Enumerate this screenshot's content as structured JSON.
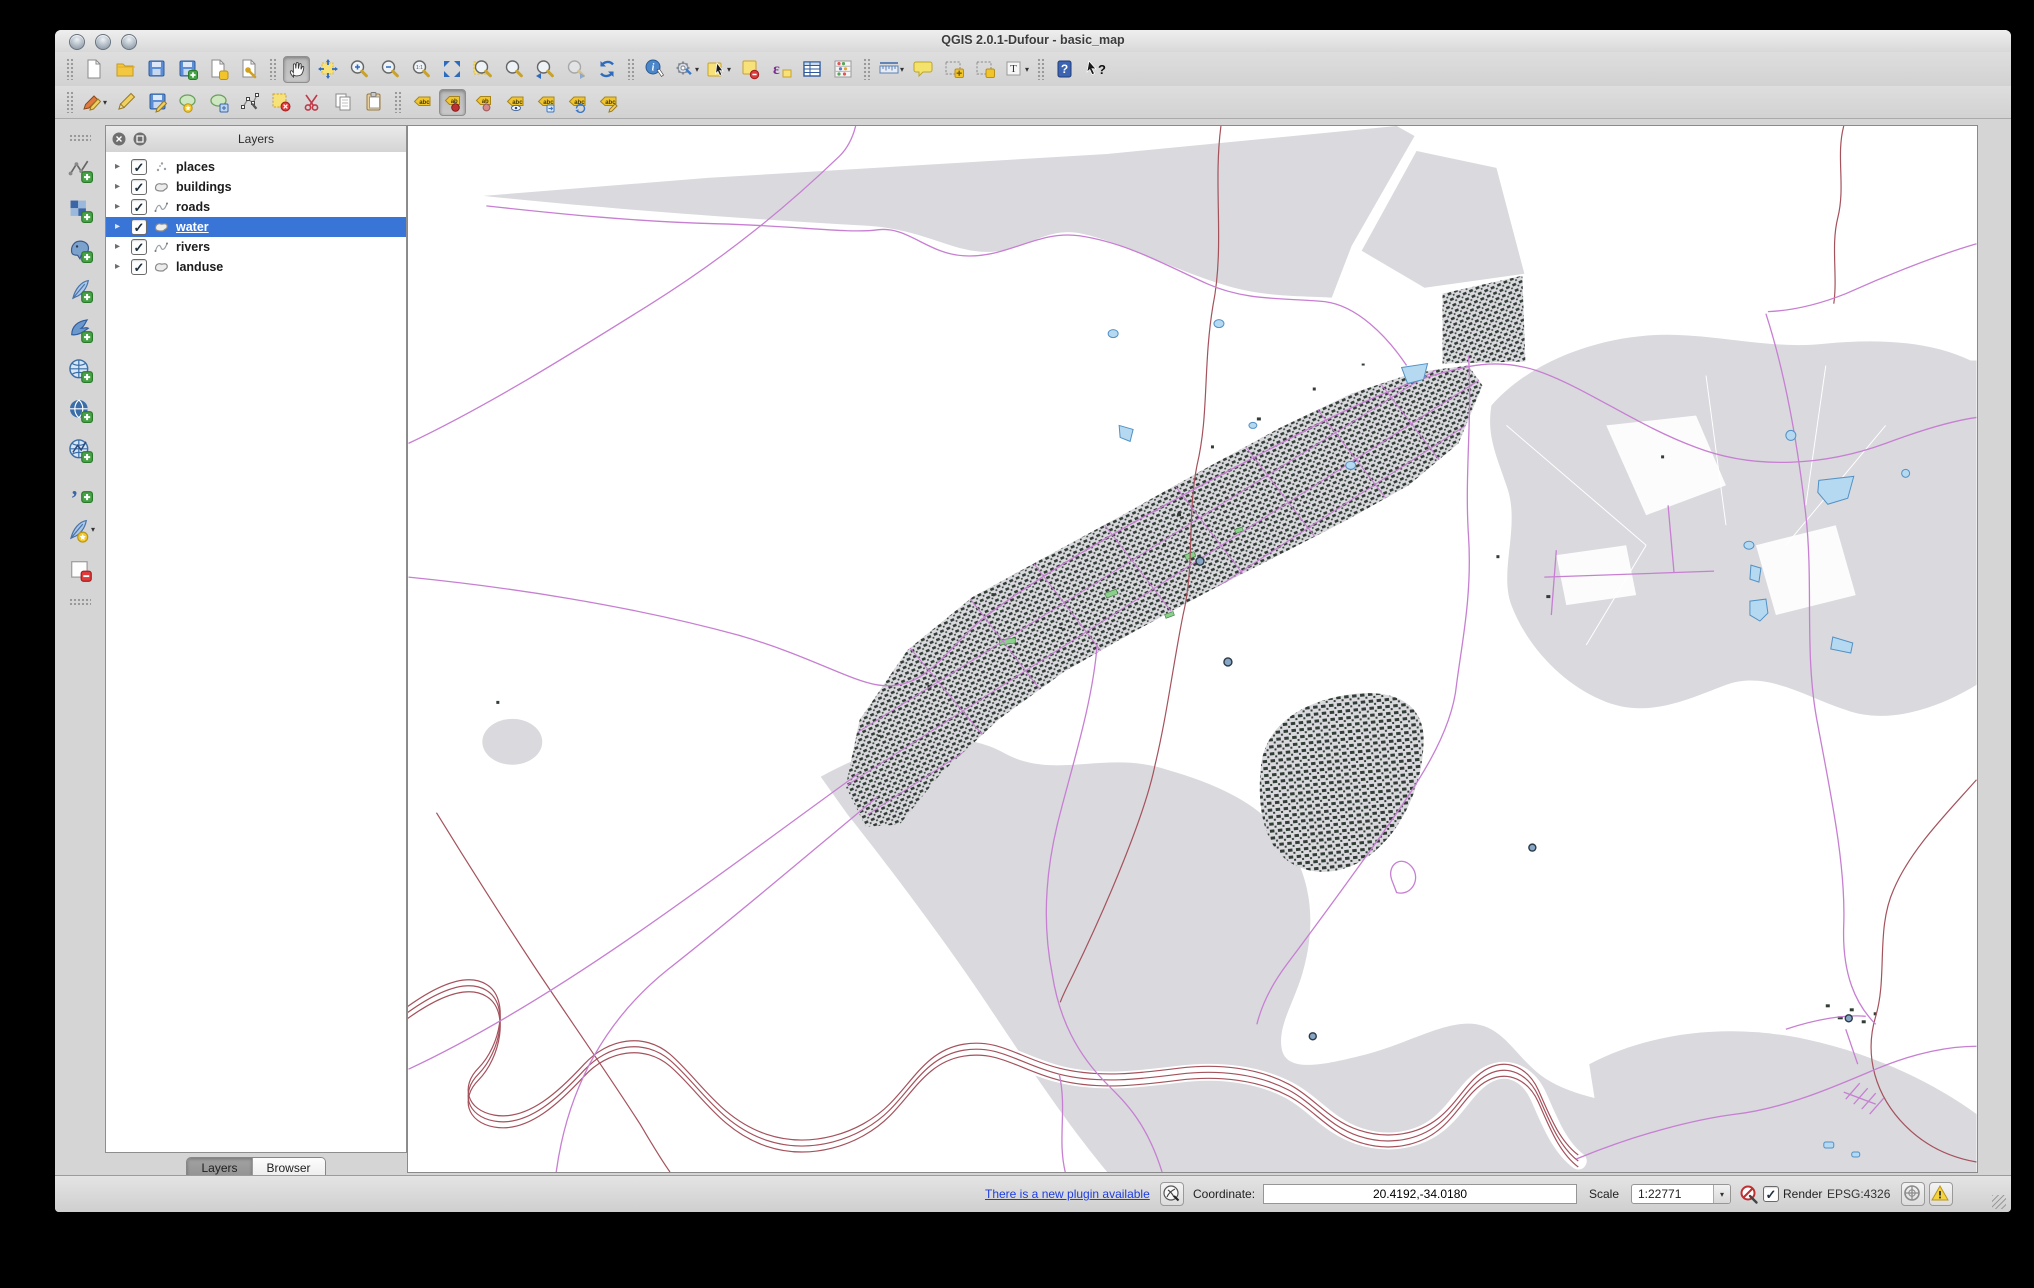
{
  "window": {
    "title": "QGIS 2.0.1-Dufour - basic_map"
  },
  "titlebar": {
    "buttons": [
      "close",
      "minimize",
      "zoom"
    ]
  },
  "toolbars": {
    "main": [
      {
        "sep": true
      },
      {
        "name": "new-project",
        "icon": "page"
      },
      {
        "name": "open-project",
        "icon": "folder"
      },
      {
        "name": "save-project",
        "icon": "floppy"
      },
      {
        "name": "save-project-as",
        "icon": "floppy-plus"
      },
      {
        "name": "new-print-composer",
        "icon": "page-plus"
      },
      {
        "name": "composer-manager",
        "icon": "page-wrench"
      },
      {
        "sep": true
      },
      {
        "name": "pan-map",
        "icon": "hand",
        "active": true
      },
      {
        "name": "pan-to-selection",
        "icon": "pan-selection"
      },
      {
        "name": "zoom-in",
        "icon": "zoom-in"
      },
      {
        "name": "zoom-out",
        "icon": "zoom-out"
      },
      {
        "name": "zoom-actual-size",
        "icon": "zoom-actual"
      },
      {
        "name": "zoom-full-extent",
        "icon": "zoom-full"
      },
      {
        "name": "zoom-to-selection",
        "icon": "zoom-selection"
      },
      {
        "name": "zoom-to-layer",
        "icon": "zoom-layer"
      },
      {
        "name": "zoom-last",
        "icon": "zoom-last"
      },
      {
        "name": "zoom-next",
        "icon": "zoom-next",
        "disabled": true
      },
      {
        "name": "refresh-map",
        "icon": "refresh"
      },
      {
        "sep": true
      },
      {
        "name": "identify-features",
        "icon": "identify"
      },
      {
        "name": "run-feature-action",
        "icon": "feature-action",
        "dropdown": true
      },
      {
        "name": "select-features",
        "icon": "select-rectangle",
        "dropdown": true
      },
      {
        "name": "deselect-features",
        "icon": "deselect"
      },
      {
        "name": "select-by-expression",
        "icon": "select-expression"
      },
      {
        "name": "open-attribute-table",
        "icon": "attribute-table"
      },
      {
        "name": "field-calculator",
        "icon": "field-calculator"
      },
      {
        "sep": true
      },
      {
        "name": "measure-line",
        "icon": "measure",
        "dropdown": true
      },
      {
        "name": "map-tips",
        "icon": "map-tips"
      },
      {
        "name": "new-bookmark",
        "icon": "bookmark-new"
      },
      {
        "name": "show-bookmarks",
        "icon": "bookmark-show"
      },
      {
        "name": "text-annotation",
        "icon": "text-annotation",
        "dropdown": true
      },
      {
        "sep": true
      },
      {
        "name": "help-contents",
        "icon": "help"
      },
      {
        "name": "whats-this",
        "icon": "whats-this"
      }
    ],
    "digitizing": [
      {
        "sep": true
      },
      {
        "name": "current-edits",
        "icon": "current-edits",
        "dropdown": true
      },
      {
        "name": "toggle-editing",
        "icon": "toggle-editing"
      },
      {
        "name": "save-layer-edits",
        "icon": "save-edits"
      },
      {
        "name": "add-feature",
        "icon": "add-feature"
      },
      {
        "name": "move-feature",
        "icon": "move-feature"
      },
      {
        "name": "node-tool",
        "icon": "node-tool"
      },
      {
        "name": "delete-selected",
        "icon": "delete-selected"
      },
      {
        "name": "cut-features",
        "icon": "cut-features"
      },
      {
        "name": "copy-features",
        "icon": "copy-features"
      },
      {
        "name": "paste-features",
        "icon": "paste-features"
      },
      {
        "sep": true
      },
      {
        "name": "layer-labeling-options",
        "icon": "label-options"
      },
      {
        "name": "pin-labels",
        "icon": "label-pin",
        "active": true
      },
      {
        "name": "highlight-pinned-labels",
        "icon": "label-pin-toggle"
      },
      {
        "name": "show-hide-labels",
        "icon": "label-visibility"
      },
      {
        "name": "move-label",
        "icon": "label-move"
      },
      {
        "name": "rotate-label",
        "icon": "label-rotate"
      },
      {
        "name": "change-label",
        "icon": "label-properties"
      }
    ],
    "layer_tools": [
      {
        "sep": true
      },
      {
        "name": "add-vector-layer",
        "icon": "add-vector"
      },
      {
        "name": "add-raster-layer",
        "icon": "add-raster"
      },
      {
        "name": "add-postgis-layer",
        "icon": "add-postgis"
      },
      {
        "name": "add-spatialite-layer",
        "icon": "add-spatialite"
      },
      {
        "name": "add-mssql-layer",
        "icon": "add-mssql"
      },
      {
        "name": "add-wms-layer",
        "icon": "add-wms"
      },
      {
        "name": "add-wcs-layer",
        "icon": "add-wcs"
      },
      {
        "name": "add-wfs-layer",
        "icon": "add-wfs"
      },
      {
        "name": "add-delimited-text-layer",
        "icon": "add-delimited-text"
      },
      {
        "name": "new-shapefile-layer",
        "icon": "new-shapefile",
        "dropdown": true
      },
      {
        "name": "remove-layer",
        "icon": "remove-layer"
      },
      {
        "sep": true
      }
    ]
  },
  "layers_panel": {
    "title": "Layers",
    "selection_color": "#3875d7",
    "layers": [
      {
        "label": "places",
        "geometry": "point",
        "checked": true,
        "selected": false
      },
      {
        "label": "buildings",
        "geometry": "polygon",
        "checked": true,
        "selected": false
      },
      {
        "label": "roads",
        "geometry": "line",
        "checked": true,
        "selected": false
      },
      {
        "label": "water",
        "geometry": "polygon",
        "checked": true,
        "selected": true
      },
      {
        "label": "rivers",
        "geometry": "line",
        "checked": true,
        "selected": false
      },
      {
        "label": "landuse",
        "geometry": "polygon",
        "checked": true,
        "selected": false
      }
    ],
    "tabs": [
      {
        "label": "Layers",
        "active": true
      },
      {
        "label": "Browser",
        "active": false
      }
    ]
  },
  "status_bar": {
    "plugin_link": "There is a new plugin available",
    "coordinate_label": "Coordinate:",
    "coordinate_value": "20.4192,-34.0180",
    "scale_label": "Scale",
    "scale_value": "1:22771",
    "render_label": "Render",
    "render_checked": true,
    "crs": "EPSG:4326"
  },
  "map": {
    "colors": {
      "landuse": "#d9d9de",
      "roads": "#c77fd2",
      "rivers": "#a4525c",
      "water_fill": "#b5d9f0",
      "water_stroke": "#5291c4",
      "buildings": "#323d35",
      "buildings_green": "#8ccf8c",
      "places": "#87a5c4",
      "places_stroke": "#2b3a46",
      "canvas": "#ffffff"
    }
  }
}
